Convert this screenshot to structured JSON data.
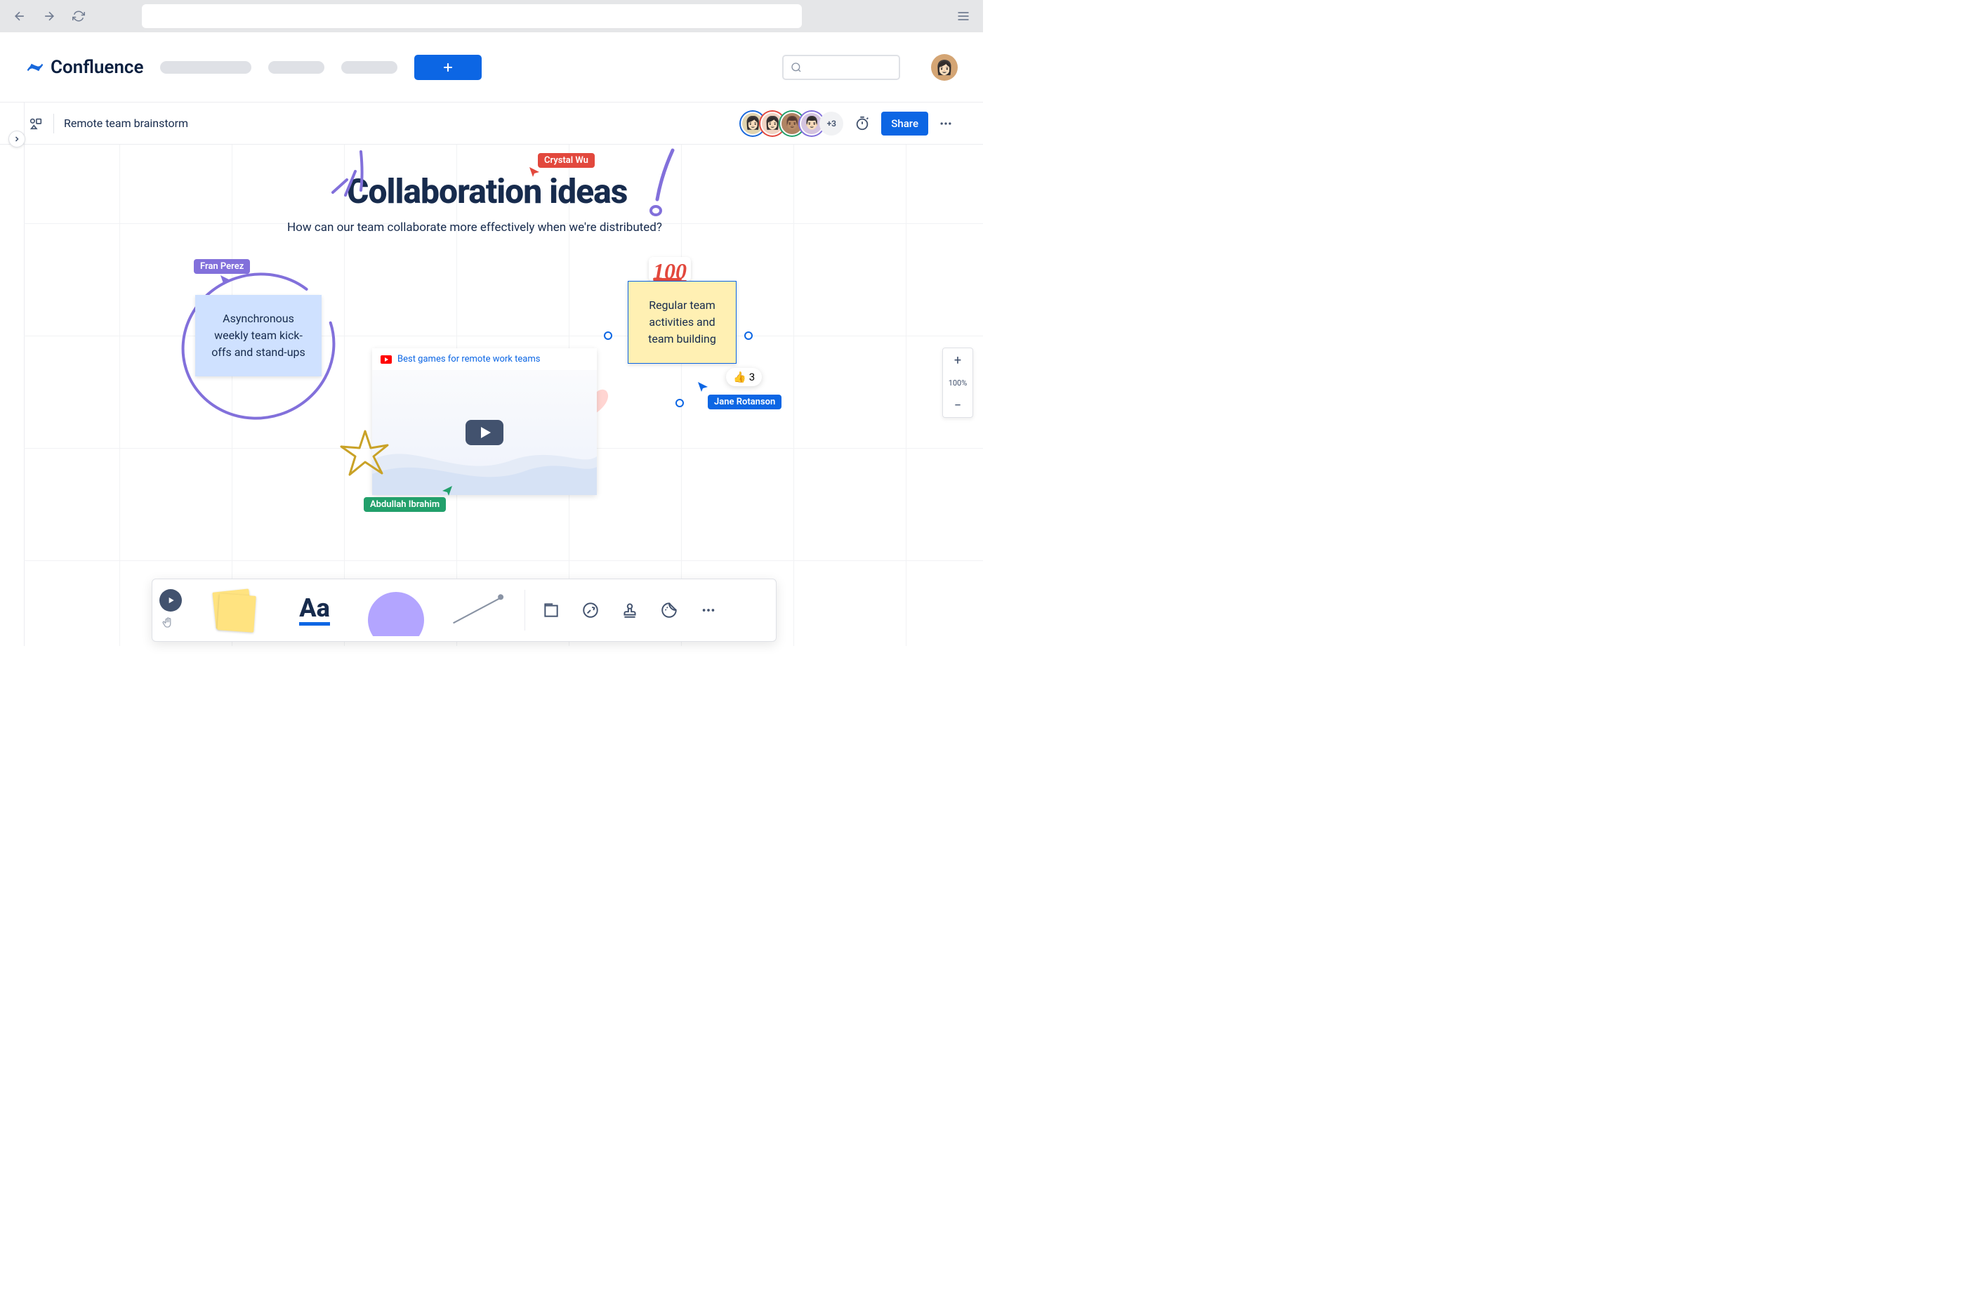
{
  "app": {
    "name": "Confluence"
  },
  "document": {
    "title": "Remote team brainstorm"
  },
  "header": {
    "share_label": "Share"
  },
  "presence": {
    "more_count": "+3"
  },
  "canvas": {
    "heading": "Collaboration ideas",
    "subtitle": "How can our team collaborate more effectively when we're distributed?"
  },
  "cursors": {
    "crystal": "Crystal Wu",
    "fran": "Fran Perez",
    "abdullah": "Abdullah Ibrahim",
    "jane": "Jane Rotanson"
  },
  "sticky": {
    "blue": "Asynchronous weekly team kick-offs and stand-ups",
    "yellow": "Regular team activities and team building"
  },
  "sticker": {
    "hundred": "100"
  },
  "reaction": {
    "thumb": "👍",
    "count": "3"
  },
  "video": {
    "title": "Best games for remote work teams"
  },
  "zoom": {
    "level": "100%"
  },
  "toolbar": {
    "text_label": "Aa"
  }
}
